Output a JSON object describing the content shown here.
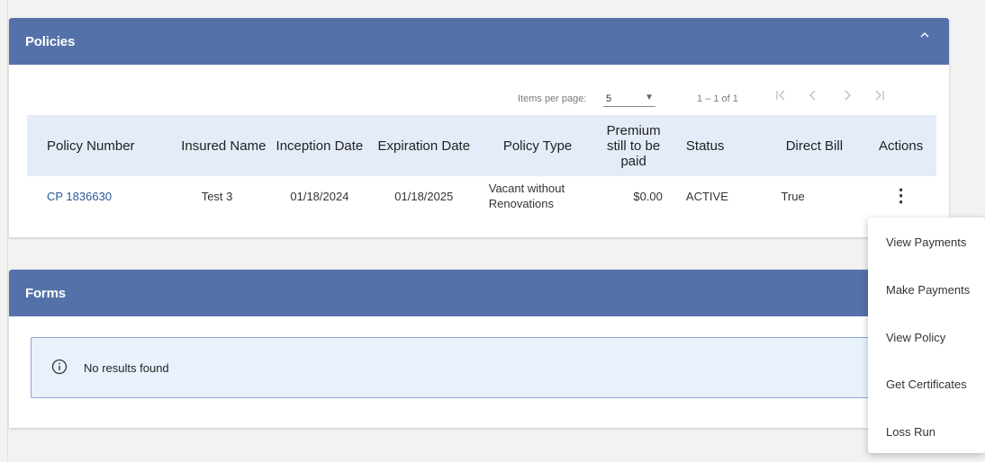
{
  "policies_panel": {
    "title": "Policies",
    "paginator": {
      "items_per_page_label": "Items per page:",
      "items_per_page_value": "5",
      "range_label": "1 – 1 of 1"
    },
    "table": {
      "headers": {
        "policy_number": "Policy Number",
        "insured_name": "Insured Name",
        "inception_date": "Inception Date",
        "expiration_date": "Expiration Date",
        "policy_type": "Policy Type",
        "premium": "Premium still to be paid",
        "status": "Status",
        "direct_bill": "Direct Bill",
        "actions": "Actions"
      },
      "rows": [
        {
          "policy_number": "CP 1836630",
          "insured_name": "Test 3",
          "inception_date": "01/18/2024",
          "expiration_date": "01/18/2025",
          "policy_type": "Vacant without Renovations",
          "premium": "$0.00",
          "status": "ACTIVE",
          "direct_bill": "True"
        }
      ]
    }
  },
  "forms_panel": {
    "title": "Forms",
    "empty_message": "No results found"
  },
  "actions_menu": {
    "items": [
      "View Payments",
      "Make Payments",
      "View Policy",
      "Get Certificates",
      "Loss Run"
    ]
  },
  "colors": {
    "header_bar": "#5472a9",
    "table_header_bg": "#e3ecf8",
    "notice_bg": "#e9f2fc",
    "link": "#2b5a95"
  },
  "icons": {
    "collapse": "chevron-up-icon",
    "info": "info-icon",
    "row_actions": "more-vertical-icon",
    "first_page": "first-page-icon",
    "prev_page": "chevron-left-icon",
    "next_page": "chevron-right-icon",
    "last_page": "last-page-icon"
  }
}
